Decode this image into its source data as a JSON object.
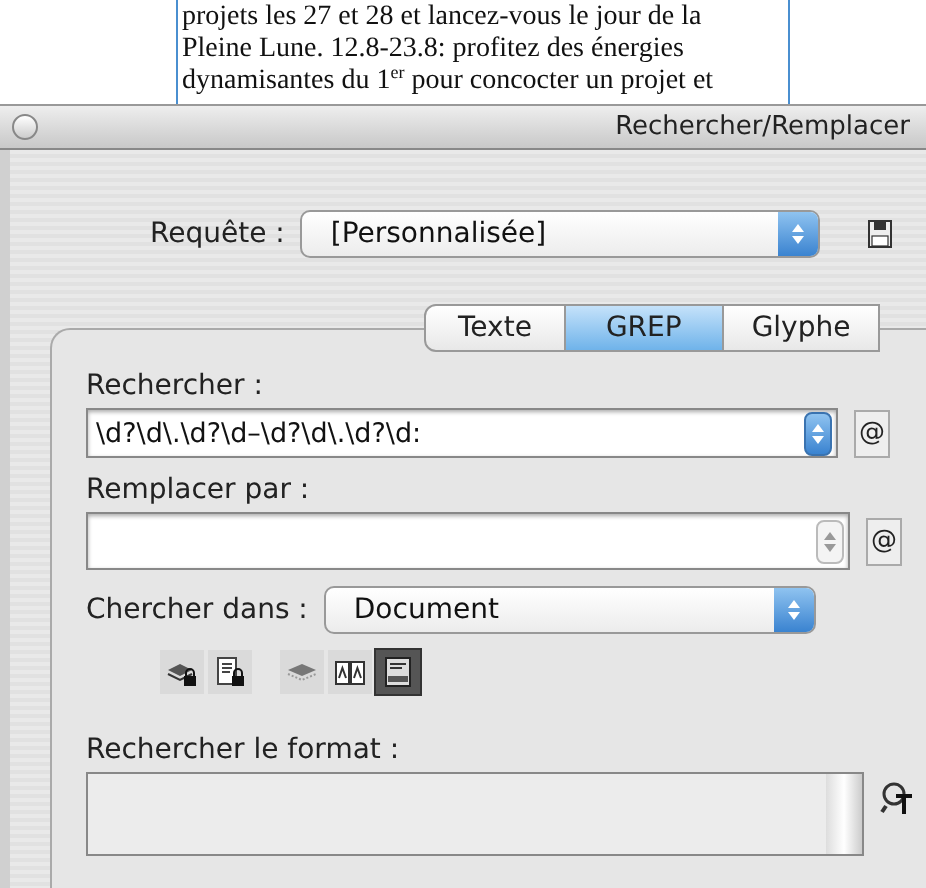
{
  "document": {
    "lines": [
      "projets les 27 et 28 et lancez-vous le jour de la",
      "Pleine Lune. 12.8-23.8: profitez des énergies",
      "dynamisantes du 1$^{er}$ pour concocter un projet et"
    ]
  },
  "window": {
    "title": "Rechercher/Remplacer"
  },
  "query": {
    "label": "Requête :",
    "value": "[Personnalisée]"
  },
  "tabs": [
    {
      "label": "Texte",
      "selected": false
    },
    {
      "label": "GREP",
      "selected": true
    },
    {
      "label": "Glyphe",
      "selected": false
    }
  ],
  "find": {
    "label": "Rechercher :",
    "value": "\\d?\\d\\.\\d?\\d–\\d?\\d\\.\\d?\\d:",
    "history_active": true,
    "special_button": "@"
  },
  "replace": {
    "label": "Remplacer par :",
    "history_active": false,
    "special_button": "@"
  },
  "search_in": {
    "label": "Chercher dans :",
    "value": "Document"
  },
  "options": [
    {
      "kind": "locked-layers",
      "selected": false
    },
    {
      "kind": "locked-stories",
      "selected": false
    },
    {
      "kind": "hidden-layers",
      "selected": false
    },
    {
      "kind": "master-pages",
      "selected": false
    },
    {
      "kind": "footnotes",
      "selected": true
    }
  ],
  "find_format": {
    "label": "Rechercher le format :"
  }
}
